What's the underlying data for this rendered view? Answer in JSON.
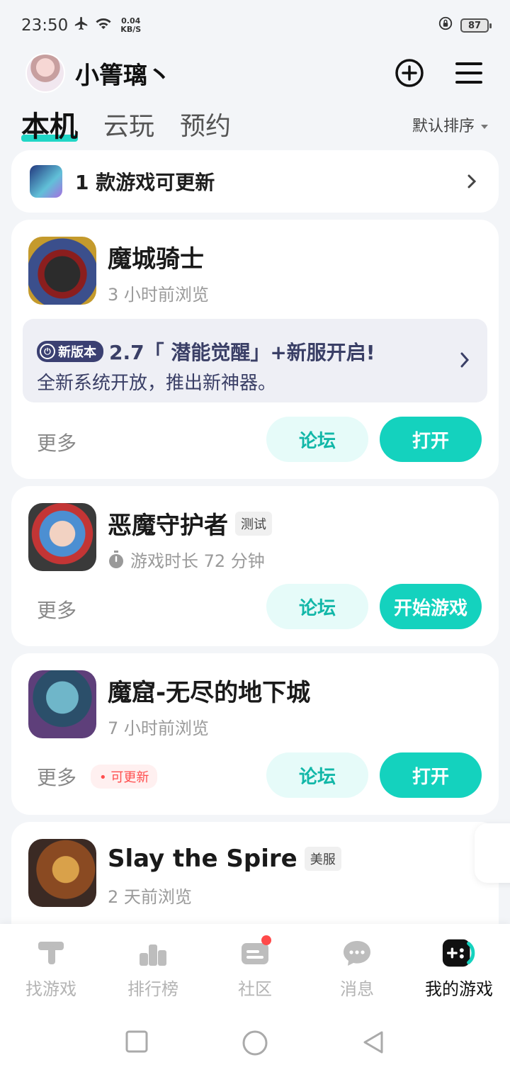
{
  "status": {
    "time": "23:50",
    "speed_value": "0.04",
    "speed_unit": "KB/S",
    "battery": "87"
  },
  "header": {
    "username": "小箐璃丶"
  },
  "tabs": [
    {
      "label": "本机"
    },
    {
      "label": "云玩"
    },
    {
      "label": "预约"
    }
  ],
  "sort": {
    "label": "默认排序"
  },
  "update_banner": {
    "text": "1 款游戏可更新"
  },
  "games": [
    {
      "title": "魔城骑士",
      "subtitle": "3 小时前浏览",
      "notice": {
        "badge": "新版本",
        "headline": "2.7「 潜能觉醒」+新服开启!",
        "detail": "全新系统开放，推出新神器。"
      },
      "more": "更多",
      "forum": "论坛",
      "action": "打开"
    },
    {
      "title": "恶魔守护者",
      "tag": "测试",
      "subtitle": "游戏时长 72 分钟",
      "more": "更多",
      "forum": "论坛",
      "action": "开始游戏"
    },
    {
      "title": "魔窟-无尽的地下城",
      "subtitle": "7 小时前浏览",
      "more": "更多",
      "update_badge": "可更新",
      "forum": "论坛",
      "action": "打开"
    },
    {
      "title": "Slay the Spire",
      "tag": "美服",
      "subtitle": "2 天前浏览"
    }
  ],
  "nav": [
    {
      "label": "找游戏"
    },
    {
      "label": "排行榜"
    },
    {
      "label": "社区"
    },
    {
      "label": "消息"
    },
    {
      "label": "我的游戏"
    }
  ],
  "colors": {
    "accent": "#14d2be",
    "notice_text": "#3a3f66"
  }
}
